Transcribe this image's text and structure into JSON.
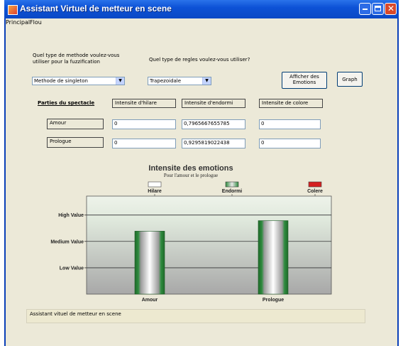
{
  "window": {
    "title": "Assistant Virtuel de metteur en scene"
  },
  "menu": {
    "items": [
      "Principal",
      "Flou"
    ]
  },
  "form": {
    "method_question": "Quel type de methode voulez-vous utiliser pour la fuzzification",
    "rules_question": "Quel type de regles voulez-vous utiliser?",
    "method_select": "Methode de singleton",
    "rules_select": "Trapezoidale",
    "show_emotions_button": "Afficher des Emotions",
    "graph_button": "Graph",
    "parts_heading": "Parties du spectacle",
    "col_hilare": "Intensite d'hilare",
    "col_endormi": "Intensite d'endormi",
    "col_colere": "Intensite de colore",
    "rows": [
      {
        "label": "Amour",
        "hilare": "0",
        "endormi": "0,7965667655785",
        "colere": "0"
      },
      {
        "label": "Prologue",
        "hilare": "0",
        "endormi": "0,9295819022438",
        "colere": "0"
      }
    ]
  },
  "chart_data": {
    "type": "bar",
    "title": "Intensite des emotions",
    "subtitle": "Pour l'amour et le prologue",
    "categories": [
      "Amour",
      "Prologue"
    ],
    "series": [
      {
        "name": "Hilare",
        "values": [
          0,
          0
        ],
        "color": "#ffffff"
      },
      {
        "name": "Endormi",
        "values": [
          0.7965667655785,
          0.9295819022438
        ],
        "color": "#2e8b3e"
      },
      {
        "name": "Colere",
        "values": [
          0,
          0
        ],
        "color": "#d42020"
      }
    ],
    "y_tick_labels": [
      "Low Value",
      "Medium Value",
      "High Value"
    ],
    "y_tick_values": [
      0.333,
      0.667,
      1.0
    ],
    "ylim": [
      0,
      1.24
    ],
    "legend_position": "top"
  },
  "status": {
    "text": "Assistant vituel de metteur en scene"
  },
  "colors": {
    "titlebar": "#0d52d6",
    "window_bg": "#ece9d8"
  },
  "icons": {
    "app": "app-icon",
    "minimize": "minimize-icon",
    "maximize": "maximize-icon",
    "close": "close-icon"
  }
}
